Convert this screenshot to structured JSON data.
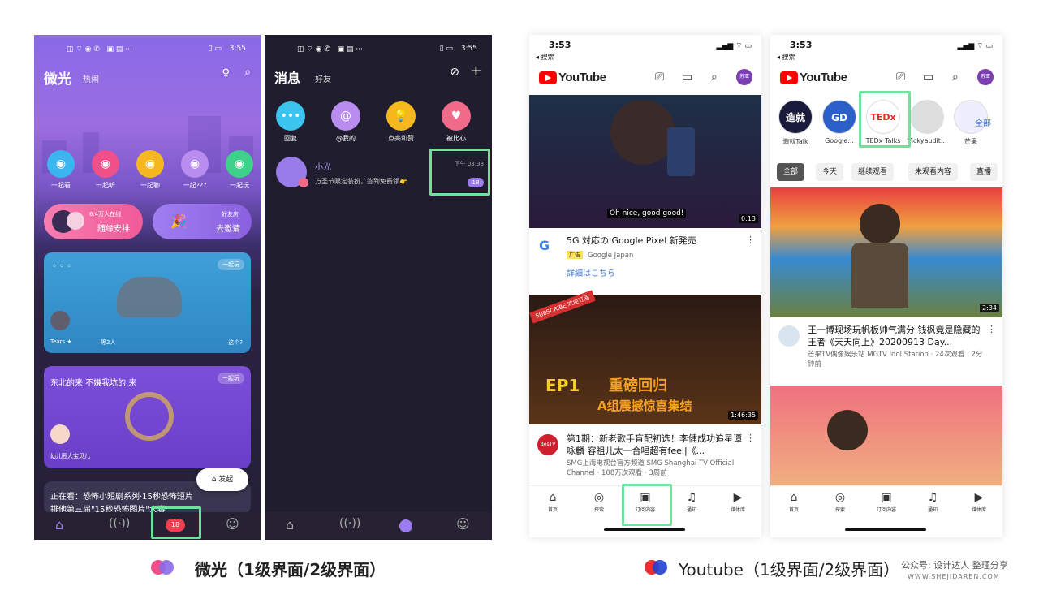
{
  "weiguang_home": {
    "status_time": "3:55",
    "title": "微光",
    "tab_hot": "热闹",
    "games": [
      {
        "label": "一起看",
        "color": "#3cb4f0"
      },
      {
        "label": "一起听",
        "color": "#f0508a"
      },
      {
        "label": "一起聊",
        "color": "#f5b81e"
      },
      {
        "label": "一起???",
        "color": "#b98cf0"
      },
      {
        "label": "一起玩",
        "color": "#3dd18a"
      }
    ],
    "banner_left": {
      "online": "6.4万人在线",
      "action": "随缘安排"
    },
    "banner_right": {
      "top": "好友房",
      "action": "去邀请"
    },
    "room1": {
      "title": "◦ ◦ ◦",
      "tag": "一起玩",
      "user": "Tears.★",
      "count": "等2人",
      "hint": "这个?"
    },
    "room2": {
      "title": "东北的来 不嫌我坑的 来",
      "tag": "一起玩",
      "user": "幼儿园大宝贝儿"
    },
    "room3": {
      "title": "正在看：恐怖小短剧系列·15秒恐怖短片",
      "subtitle": "排他第三届\"15秒恐怖图片\"大赛"
    },
    "launch_button": "发起",
    "badge": "18"
  },
  "weiguang_msg": {
    "status_time": "3:55",
    "title": "消息",
    "tab_friend": "好友",
    "quick": [
      {
        "label": "回复",
        "color": "#3cc4f0",
        "glyph": "•••"
      },
      {
        "label": "@我的",
        "color": "#b98cf0",
        "glyph": "@"
      },
      {
        "label": "点亮和赞",
        "color": "#f5b81e",
        "glyph": "💡"
      },
      {
        "label": "被比心",
        "color": "#f06a8a",
        "glyph": "♥"
      }
    ],
    "conversation": {
      "name": "小光",
      "preview": "万圣节限定装扮，签到免费领👉",
      "time": "下午 03:38",
      "unread": "18"
    }
  },
  "youtube_home": {
    "status_time": "3:53",
    "back": "◂ 搜索",
    "logo": "YouTube",
    "avatar": "苏亚",
    "video1": {
      "caption": "Oh nice, good good!",
      "duration": "0:13",
      "title": "5G 対応の Google Pixel 新発売",
      "ad": "广告",
      "channel": "Google Japan",
      "link": "詳細はこちら"
    },
    "video2": {
      "banner": "SUBSCRIBE 欢迎订阅",
      "overlay": "重磅回归",
      "overlay2": "A组震撼惊喜集结",
      "ep": "EP1",
      "duration": "1:46:35",
      "channel_icon": "BesTV",
      "title": "第1期：新老歌手盲配初选！李健成功追星谭咏麟 容祖儿太一合唱超有feel|《...",
      "meta": "SMG上海电视台官方频道 SMG Shanghai TV Official Channel · 108万次观看 · 3周前"
    },
    "tabs": [
      "首页",
      "探索",
      "订阅内容",
      "通知",
      "媒体库"
    ]
  },
  "youtube_subs": {
    "status_time": "3:53",
    "back": "◂ 搜索",
    "logo": "YouTube",
    "avatar": "苏亚",
    "channels": [
      {
        "name": "造就Talk",
        "mark": "造就"
      },
      {
        "name": "Google...",
        "mark": "GD"
      },
      {
        "name": "TEDx Talks",
        "mark": "TEDx"
      },
      {
        "name": "Vickyaudit...",
        "mark": ""
      },
      {
        "name": "芒果",
        "mark": ""
      }
    ],
    "all": "全部",
    "chips": [
      "全部",
      "今天",
      "继续观看",
      "未观看内容",
      "直播"
    ],
    "video1": {
      "duration": "2:34",
      "title": "王一博现场玩帆板帅气满分 钱枫竟是隐藏的王者《天天向上》20200913 Day...",
      "meta": "芒果TV偶像娱乐站 MGTV Idol Station · 24次观看 · 2分钟前"
    },
    "tabs": [
      "首页",
      "探索",
      "订阅内容",
      "通知",
      "媒体库"
    ]
  },
  "captions": {
    "left": "微光（1级界面/2级界面）",
    "right": "Youtube（1级界面/2级界面）",
    "watermark": "公众号: 设计达人 整理分享",
    "site": "WWW.SHEJIDAREN.COM"
  }
}
